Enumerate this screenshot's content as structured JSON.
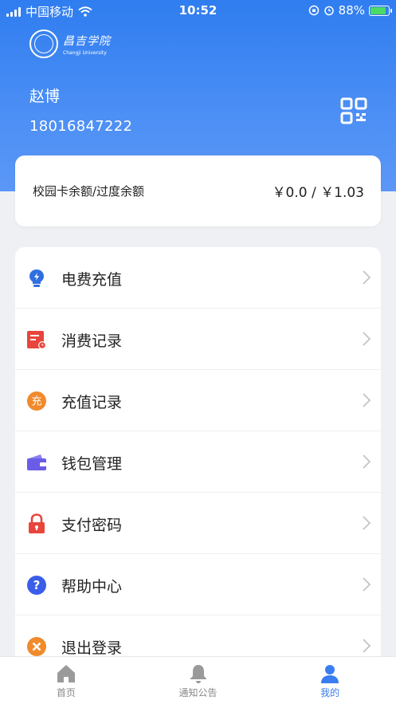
{
  "status_bar": {
    "carrier": "中国移动",
    "time": "10:52",
    "battery_percent": "88%",
    "battery_level": 0.88
  },
  "header": {
    "logo_text_cn": "昌吉学院",
    "logo_text_en": "Changji University",
    "user_name": "赵博",
    "phone": "18016847222",
    "qr_icon": "qr-code-icon"
  },
  "balance": {
    "label": "校园卡余额/过度余额",
    "values": "￥0.0 /  ￥1.03"
  },
  "menu": {
    "items": [
      {
        "label": "电费充值",
        "icon": "bulb-icon",
        "color": "#2f6fe0"
      },
      {
        "label": "消费记录",
        "icon": "receipt-icon",
        "color": "#e8453c"
      },
      {
        "label": "充值记录",
        "icon": "recharge-icon",
        "color": "#f08a2c",
        "icon_text": "充"
      },
      {
        "label": "钱包管理",
        "icon": "wallet-icon",
        "color": "#6b5ce7"
      },
      {
        "label": "支付密码",
        "icon": "lock-icon",
        "color": "#e8453c"
      },
      {
        "label": "帮助中心",
        "icon": "help-icon",
        "color": "#3a5ee8",
        "icon_text": "?"
      },
      {
        "label": "退出登录",
        "icon": "close-circle-icon",
        "color": "#f08a2c"
      }
    ]
  },
  "tabbar": {
    "tabs": [
      {
        "label": "首页",
        "icon": "home-icon"
      },
      {
        "label": "通知公告",
        "icon": "bell-icon"
      },
      {
        "label": "我的",
        "icon": "user-icon",
        "active": true
      }
    ]
  },
  "colors": {
    "primary": "#3a7df0",
    "header_gradient_top": "#2f7df0",
    "background": "#eef0f3"
  }
}
